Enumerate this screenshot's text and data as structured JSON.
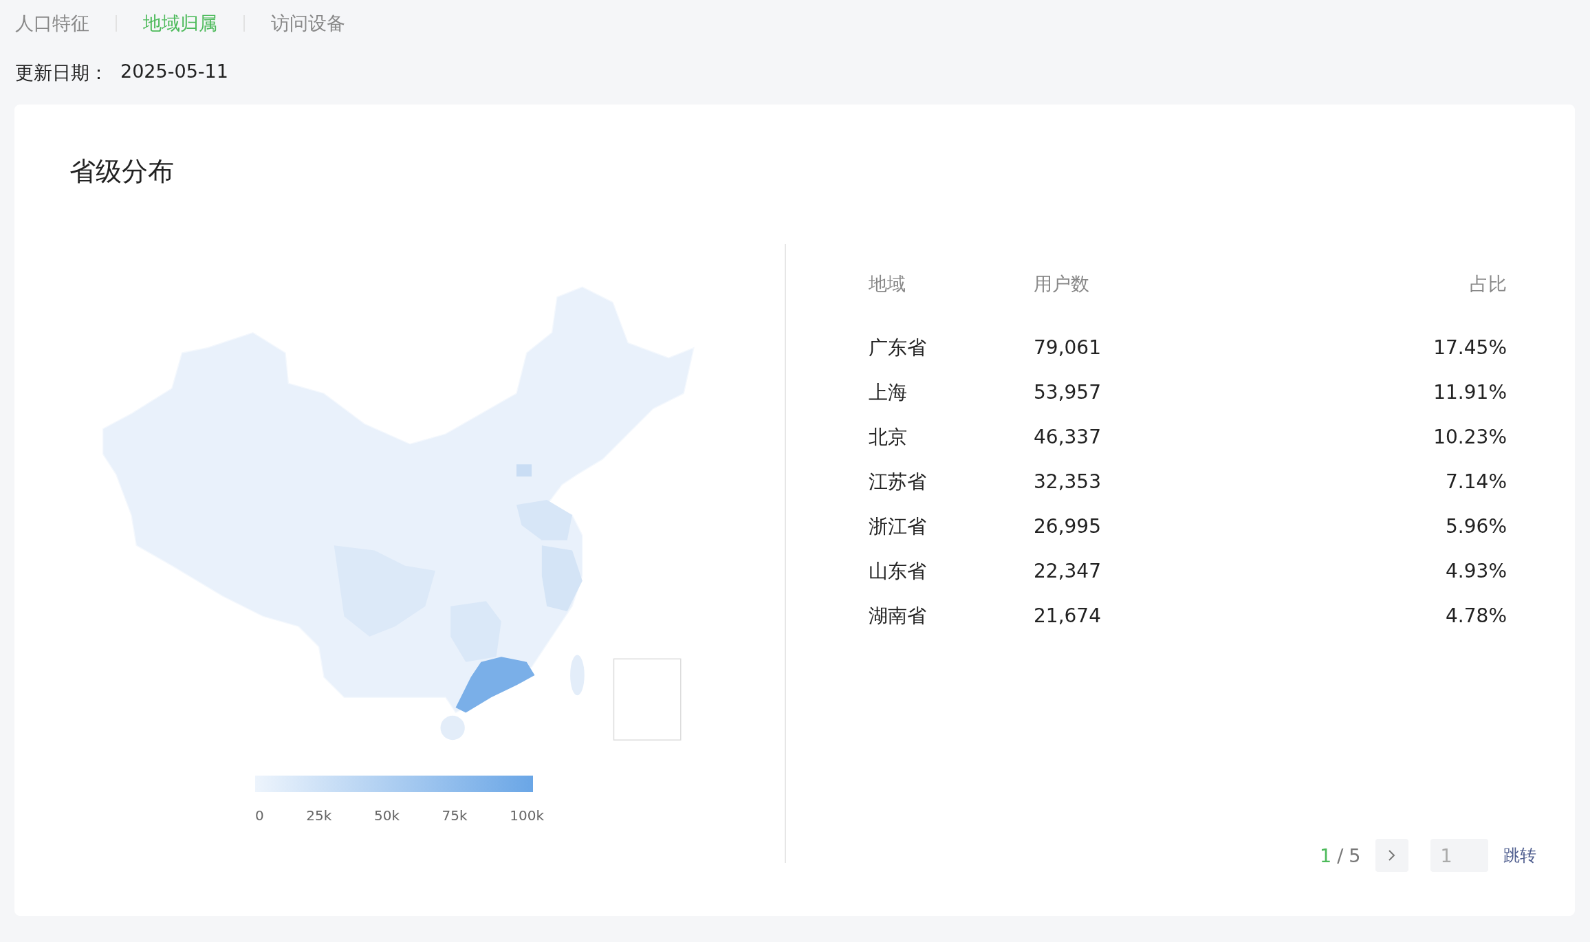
{
  "tabs": [
    {
      "label": "人口特征",
      "selected": false
    },
    {
      "label": "地域归属",
      "selected": true
    },
    {
      "label": "访问设备",
      "selected": false
    }
  ],
  "update": {
    "label": "更新日期：",
    "value": "2025-05-11"
  },
  "card": {
    "title": "省级分布",
    "legend": {
      "ticks": [
        "0",
        "25k",
        "50k",
        "75k",
        "100k"
      ]
    },
    "table": {
      "columns": [
        "地域",
        "用户数",
        "占比"
      ],
      "rows": [
        [
          "广东省",
          "79,061",
          "17.45%"
        ],
        [
          "上海",
          "53,957",
          "11.91%"
        ],
        [
          "北京",
          "46,337",
          "10.23%"
        ],
        [
          "江苏省",
          "32,353",
          "7.14%"
        ],
        [
          "浙江省",
          "26,995",
          "5.96%"
        ],
        [
          "山东省",
          "22,347",
          "4.93%"
        ],
        [
          "湖南省",
          "21,674",
          "4.78%"
        ]
      ]
    },
    "pagination": {
      "current": "1",
      "separator": "/",
      "total": "5",
      "jump_placeholder": "1",
      "jump_button": "跳转"
    }
  }
}
